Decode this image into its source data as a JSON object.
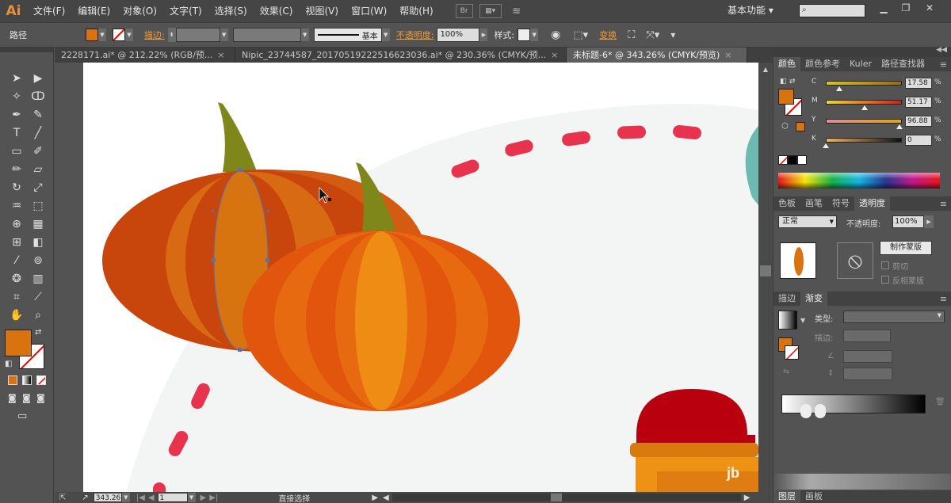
{
  "app": {
    "logo": "Ai",
    "workspace": "基本功能 ▾"
  },
  "menu": [
    "文件(F)",
    "编辑(E)",
    "对象(O)",
    "文字(T)",
    "选择(S)",
    "效果(C)",
    "视图(V)",
    "窗口(W)",
    "帮助(H)"
  ],
  "menu_icons": {
    "bridge": "Br"
  },
  "controlbar": {
    "object_type": "路径",
    "stroke_label": "描边:",
    "stroke_profile": "基本",
    "opacity_label": "不透明度:",
    "opacity_value": "100%",
    "style_label": "样式:",
    "transform_label": "变换",
    "fill_color": "#d7740f"
  },
  "tabs": [
    {
      "label": "2228171.ai* @ 212.22% (RGB/预...",
      "active": false
    },
    {
      "label": "Nipic_23744587_20170519222516623036.ai* @ 230.36% (CMYK/预...",
      "active": false
    },
    {
      "label": "未标题-6* @ 343.26% (CMYK/预览)",
      "active": true
    }
  ],
  "tab_close": "×",
  "toolbar": {
    "fill_color": "#d7740f",
    "icons": [
      "selection-icon",
      "direct-selection-icon",
      "magic-wand-icon",
      "lasso-icon",
      "pen-icon",
      "curvature-icon",
      "type-icon",
      "line-icon",
      "rectangle-icon",
      "paintbrush-icon",
      "pencil-icon",
      "eraser-icon",
      "rotate-icon",
      "scale-icon",
      "warp-icon",
      "free-transform-icon",
      "shape-builder-icon",
      "perspective-icon",
      "mesh-icon",
      "gradient-icon",
      "eyedropper-icon",
      "blend-icon",
      "symbol-sprayer-icon",
      "column-graph-icon",
      "artboard-icon",
      "slice-icon",
      "hand-icon",
      "zoom-icon"
    ]
  },
  "status": {
    "zoom": "343.26",
    "page": "1",
    "tool": "直接选择"
  },
  "color_panel": {
    "tabs": [
      "颜色",
      "颜色参考",
      "Kuler",
      "路径查找器"
    ],
    "active": 0,
    "fill_color": "#d7740f",
    "channels": [
      {
        "label": "C",
        "value": "17.58",
        "level": 0.18,
        "gradient": "linear-gradient(to right,#d9c70f,#9b6a10)"
      },
      {
        "label": "M",
        "value": "51.17",
        "level": 0.51,
        "gradient": "linear-gradient(to right,#f5d81a,#d4201b)"
      },
      {
        "label": "Y",
        "value": "96.88",
        "level": 0.97,
        "gradient": "linear-gradient(to right,#e08aa0,#e6a500)"
      },
      {
        "label": "K",
        "value": "0",
        "level": 0.0,
        "gradient": "linear-gradient(to right,#f0b060,#111111)"
      }
    ],
    "unit": "%"
  },
  "transparency_panel": {
    "tabs": [
      "色板",
      "画笔",
      "符号",
      "透明度"
    ],
    "active": 3,
    "blend_mode": "正常",
    "opacity_label": "不透明度:",
    "opacity_value": "100%",
    "make_mask": "制作蒙版",
    "clip": "剪切",
    "invert_mask": "反相蒙版"
  },
  "gradient_panel": {
    "tabs": [
      "描边",
      "渐变"
    ],
    "active": 1,
    "type_label": "类型:",
    "stroke_label": "描边:"
  },
  "bottom_tabs": [
    "图层",
    "画板"
  ],
  "overlay": {
    "mark": "jb"
  }
}
